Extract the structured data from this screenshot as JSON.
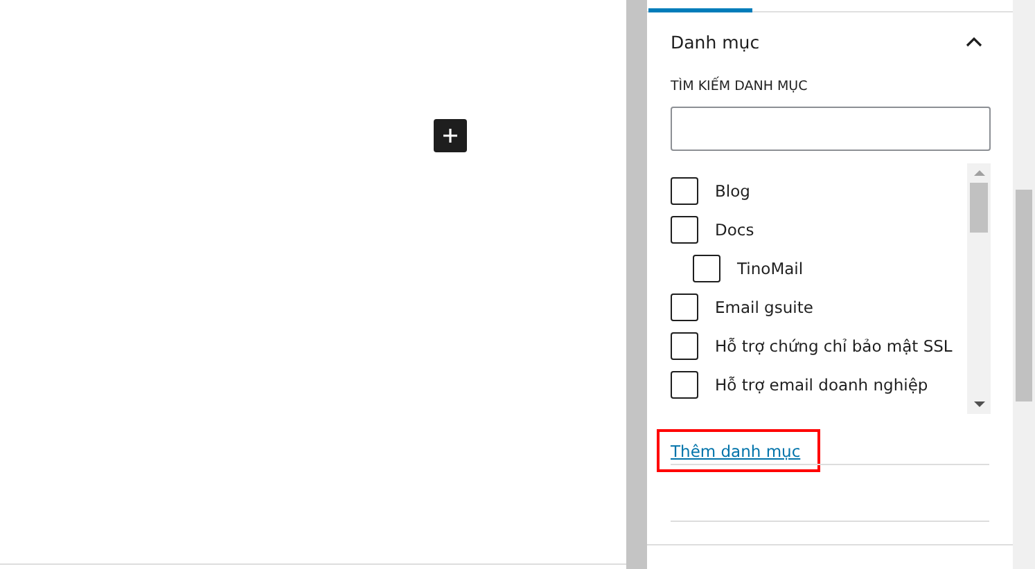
{
  "panel": {
    "title": "Danh mục",
    "expanded": true,
    "search_label": "TÌM KIẾM DANH MỤC",
    "categories": [
      {
        "label": "Blog",
        "checked": false
      },
      {
        "label": "Docs",
        "checked": false,
        "children": [
          {
            "label": "TinoMail",
            "checked": false
          }
        ]
      },
      {
        "label": "Email gsuite",
        "checked": false
      },
      {
        "label": "Hỗ trợ chứng chỉ bảo mật SSL",
        "checked": false
      },
      {
        "label": "Hỗ trợ email doanh nghiệp",
        "checked": false
      }
    ],
    "add_link": "Thêm danh mục"
  }
}
